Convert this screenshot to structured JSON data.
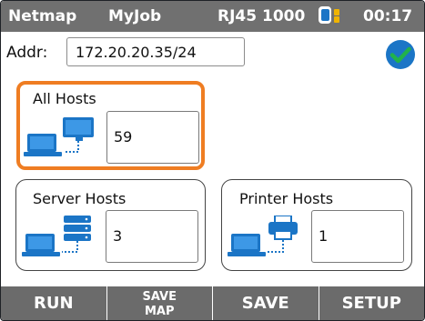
{
  "titlebar": {
    "app": "Netmap",
    "job": "MyJob",
    "link": "RJ45 1000",
    "time": "00:17",
    "battery_icon": "battery-icon",
    "colors": {
      "bar": "#707070",
      "battery": "#1b75c6",
      "battery_cap": "#f0b400"
    }
  },
  "address": {
    "label": "Addr:",
    "value": "172.20.20.35/24",
    "status_icon": "checkmark-icon",
    "status_color": "#1b75c6"
  },
  "panels": {
    "all_hosts": {
      "title": "All Hosts",
      "count": "59",
      "icon": "network-hosts-icon",
      "highlight": "#ef7d22"
    },
    "server_hosts": {
      "title": "Server Hosts",
      "count": "3",
      "icon": "server-hosts-icon"
    },
    "printer_hosts": {
      "title": "Printer Hosts",
      "count": "1",
      "icon": "printer-hosts-icon"
    }
  },
  "softkeys": {
    "run": "RUN",
    "save_map_line1": "SAVE",
    "save_map_line2": "MAP",
    "save": "SAVE",
    "setup": "SETUP"
  }
}
